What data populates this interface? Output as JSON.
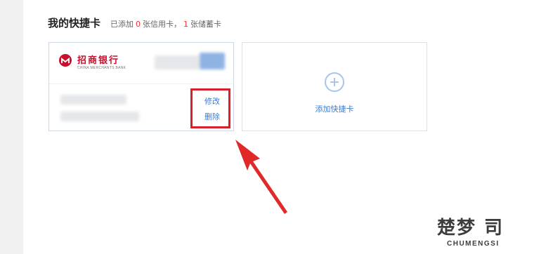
{
  "section": {
    "title": "我的快捷卡",
    "summary_prefix": "已添加",
    "credit_count": "0",
    "credit_label": "张信用卡，",
    "debit_count": "1",
    "debit_label": "张储蓄卡"
  },
  "card": {
    "bank_name": "招商银行",
    "bank_name_en": "CHINA MERCHANTS BANK",
    "edit_label": "修改",
    "delete_label": "删除"
  },
  "add_card": {
    "label": "添加快捷卡"
  },
  "watermark": {
    "main": "楚梦 司",
    "sub": "CHUMENGSI"
  },
  "colors": {
    "accent_red": "#d6202a",
    "link_blue": "#3a7bd5",
    "bank_red": "#c8102e"
  }
}
